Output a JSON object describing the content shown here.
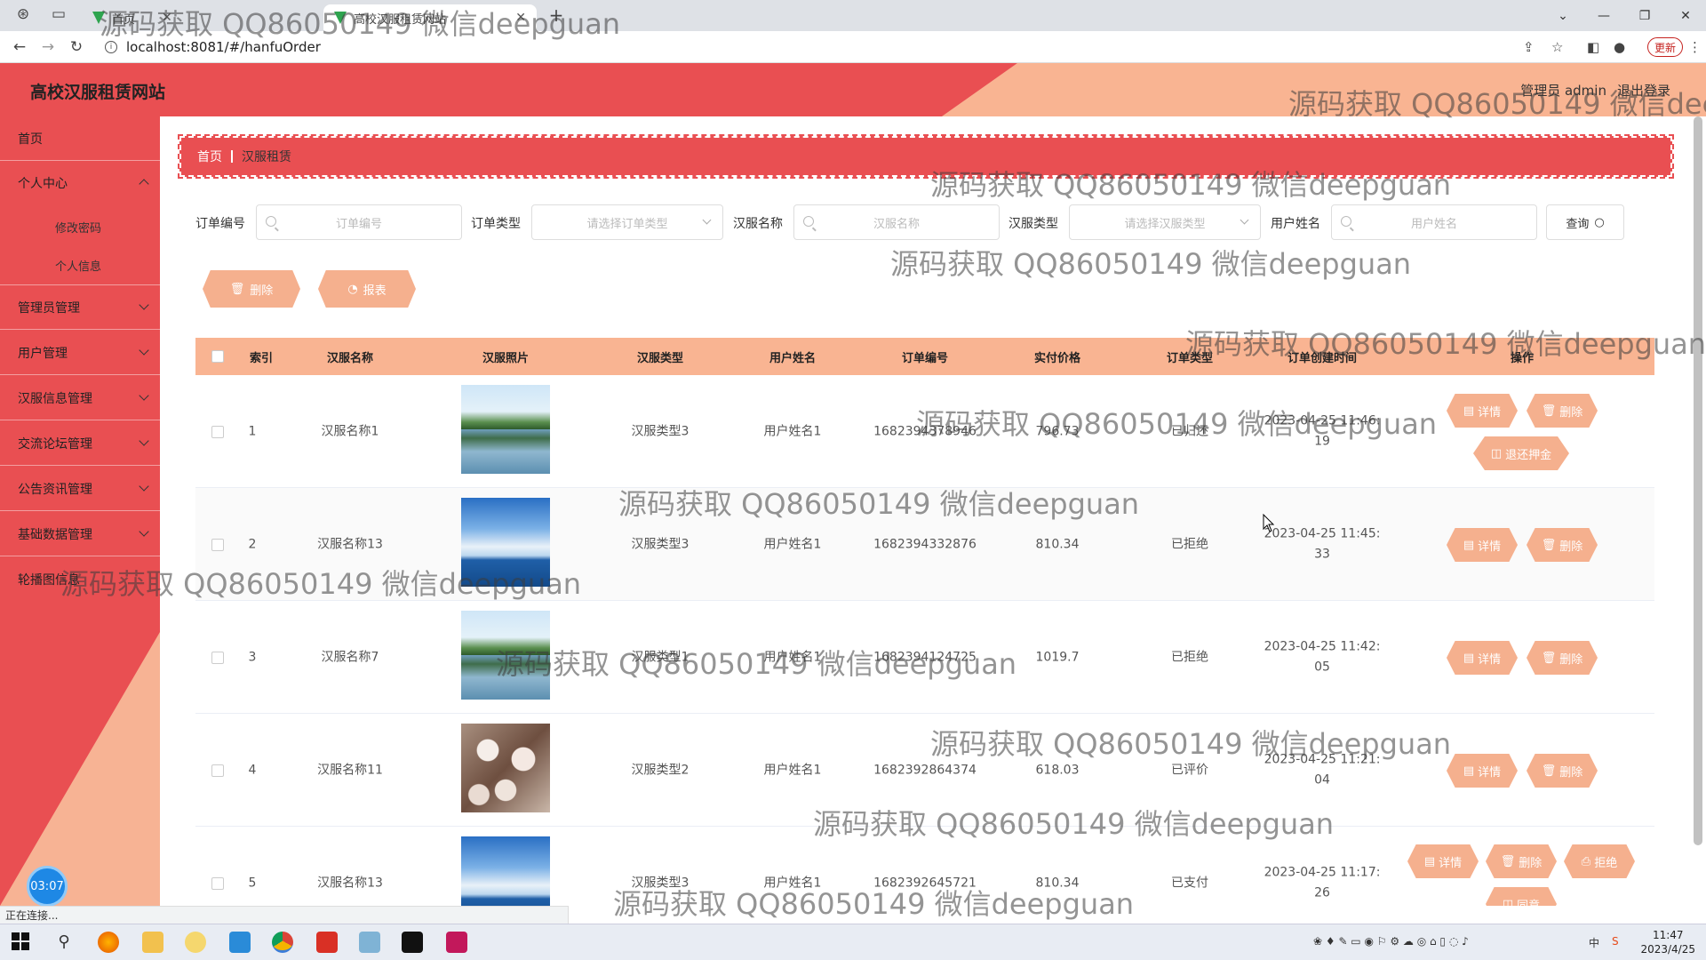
{
  "browser": {
    "tabs": [
      {
        "label": "首页"
      },
      {
        "label": "高校汉服租赁网站"
      }
    ],
    "new_tab": "+",
    "url": "localhost:8081/#/hanfuOrder",
    "update_label": "更新",
    "status_text": "正在连接..."
  },
  "header": {
    "site_title": "高校汉服租赁网站",
    "user_text": "管理员 admin",
    "logout_label": "退出登录"
  },
  "sidebar": {
    "items": [
      {
        "label": "首页"
      },
      {
        "label": "个人中心"
      },
      {
        "label": "修改密码"
      },
      {
        "label": "个人信息"
      },
      {
        "label": "管理员管理"
      },
      {
        "label": "用户管理"
      },
      {
        "label": "汉服信息管理"
      },
      {
        "label": "交流论坛管理"
      },
      {
        "label": "公告资讯管理"
      },
      {
        "label": "基础数据管理"
      },
      {
        "label": "轮播图信息"
      }
    ],
    "timer": "03:07"
  },
  "breadcrumb": {
    "home": "首页",
    "current": "汉服租赁"
  },
  "filters": {
    "order_no_label": "订单编号",
    "order_no_placeholder": "订单编号",
    "order_type_label": "订单类型",
    "order_type_placeholder": "请选择订单类型",
    "hanfu_name_label": "汉服名称",
    "hanfu_name_placeholder": "汉服名称",
    "hanfu_type_label": "汉服类型",
    "hanfu_type_placeholder": "请选择汉服类型",
    "user_name_label": "用户姓名",
    "user_name_placeholder": "用户姓名",
    "query_label": "查询"
  },
  "actions": {
    "delete_label": "删除",
    "report_label": "报表"
  },
  "table": {
    "columns": [
      "索引",
      "汉服名称",
      "汉服照片",
      "汉服类型",
      "用户姓名",
      "订单编号",
      "实付价格",
      "订单类型",
      "订单创建时间",
      "操作"
    ],
    "rows": [
      {
        "index": "1",
        "name": "汉服名称1",
        "photo": "mountain-lake",
        "type": "汉服类型3",
        "user": "用户姓名1",
        "order_no": "1682394378946",
        "price": "796.73",
        "status": "已归还",
        "time1": "2023-04-25 11:46:",
        "time2": "19",
        "ops": [
          "详情",
          "删除",
          "退还押金"
        ]
      },
      {
        "index": "2",
        "name": "汉服名称13",
        "photo": "sea-sky",
        "type": "汉服类型3",
        "user": "用户姓名1",
        "order_no": "1682394332876",
        "price": "810.34",
        "status": "已拒绝",
        "time1": "2023-04-25 11:45:",
        "time2": "33",
        "ops": [
          "详情",
          "删除"
        ]
      },
      {
        "index": "3",
        "name": "汉服名称7",
        "photo": "mountain-lake",
        "type": "汉服类型1",
        "user": "用户姓名1",
        "order_no": "1682394124725",
        "price": "1019.7",
        "status": "已拒绝",
        "time1": "2023-04-25 11:42:",
        "time2": "05",
        "ops": [
          "详情",
          "删除"
        ]
      },
      {
        "index": "4",
        "name": "汉服名称11",
        "photo": "blossom",
        "type": "汉服类型2",
        "user": "用户姓名1",
        "order_no": "1682392864374",
        "price": "618.03",
        "status": "已评价",
        "time1": "2023-04-25 11:21:",
        "time2": "04",
        "ops": [
          "详情",
          "删除"
        ]
      },
      {
        "index": "5",
        "name": "汉服名称13",
        "photo": "sea-sky",
        "type": "汉服类型3",
        "user": "用户姓名1",
        "order_no": "1682392645721",
        "price": "810.34",
        "status": "已支付",
        "time1": "2023-04-25 11:17:",
        "time2": "26",
        "ops": [
          "详情",
          "删除",
          "拒绝",
          "同意"
        ]
      }
    ]
  },
  "watermark_text": "源码获取 QQ86050149 微信deepguan",
  "taskbar": {
    "time": "11:47",
    "date": "2023/4/25",
    "ime": "中"
  },
  "colors": {
    "primary_red": "#e94f52",
    "peach": "#f9b492",
    "button": "#f5b08e"
  }
}
